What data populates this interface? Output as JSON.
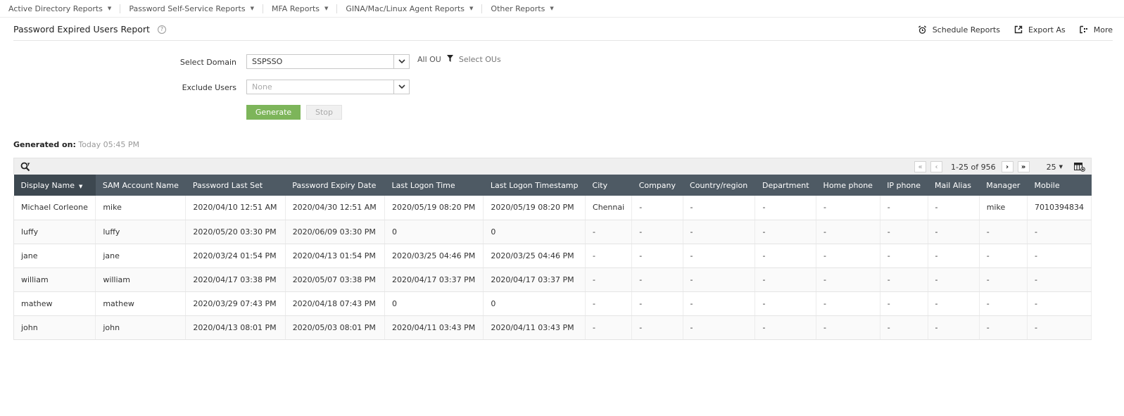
{
  "nav": {
    "items": [
      {
        "label": "Active Directory Reports"
      },
      {
        "label": "Password Self-Service Reports"
      },
      {
        "label": "MFA Reports"
      },
      {
        "label": "GINA/Mac/Linux Agent Reports"
      },
      {
        "label": "Other Reports"
      }
    ]
  },
  "header": {
    "title": "Password Expired Users Report",
    "help_icon": "?",
    "actions": {
      "schedule": "Schedule Reports",
      "export": "Export As",
      "more": "More"
    }
  },
  "form": {
    "domain_label": "Select Domain",
    "domain_value": "SSPSSO",
    "ou_label": "All OU",
    "select_ous": "Select OUs",
    "exclude_label": "Exclude Users",
    "exclude_placeholder": "None",
    "generate": "Generate",
    "stop": "Stop"
  },
  "generated": {
    "label": "Generated on:",
    "value": "Today 05:45 PM"
  },
  "pager": {
    "range": "1-25 of 956",
    "page_size": "25"
  },
  "table": {
    "columns": [
      "Display Name",
      "SAM Account Name",
      "Password Last Set",
      "Password Expiry Date",
      "Last Logon Time",
      "Last Logon Timestamp",
      "City",
      "Company",
      "Country/region",
      "Department",
      "Home phone",
      "IP phone",
      "Mail Alias",
      "Manager",
      "Mobile"
    ],
    "rows": [
      [
        "Michael Corleone",
        "mike",
        "2020/04/10 12:51 AM",
        "2020/04/30 12:51 AM",
        "2020/05/19 08:20 PM",
        "2020/05/19 08:20 PM",
        "Chennai",
        "-",
        "-",
        "-",
        "-",
        "-",
        "-",
        "mike",
        "7010394834"
      ],
      [
        "luffy",
        "luffy",
        "2020/05/20 03:30 PM",
        "2020/06/09 03:30 PM",
        "0",
        "0",
        "-",
        "-",
        "-",
        "-",
        "-",
        "-",
        "-",
        "-",
        "-"
      ],
      [
        "jane",
        "jane",
        "2020/03/24 01:54 PM",
        "2020/04/13 01:54 PM",
        "2020/03/25 04:46 PM",
        "2020/03/25 04:46 PM",
        "-",
        "-",
        "-",
        "-",
        "-",
        "-",
        "-",
        "-",
        "-"
      ],
      [
        "william",
        "william",
        "2020/04/17 03:38 PM",
        "2020/05/07 03:38 PM",
        "2020/04/17 03:37 PM",
        "2020/04/17 03:37 PM",
        "-",
        "-",
        "-",
        "-",
        "-",
        "-",
        "-",
        "-",
        "-"
      ],
      [
        "mathew",
        "mathew",
        "2020/03/29 07:43 PM",
        "2020/04/18 07:43 PM",
        "0",
        "0",
        "-",
        "-",
        "-",
        "-",
        "-",
        "-",
        "-",
        "-",
        "-"
      ],
      [
        "john",
        "john",
        "2020/04/13 08:01 PM",
        "2020/05/03 08:01 PM",
        "2020/04/11 03:43 PM",
        "2020/04/11 03:43 PM",
        "-",
        "-",
        "-",
        "-",
        "-",
        "-",
        "-",
        "-",
        "-"
      ]
    ]
  }
}
